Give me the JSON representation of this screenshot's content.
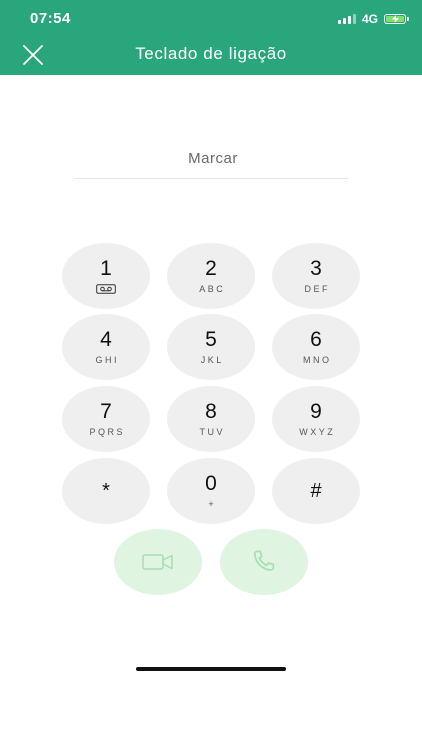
{
  "status_bar": {
    "time": "07:54",
    "network": "4G"
  },
  "header": {
    "title": "Teclado de ligação"
  },
  "dial": {
    "placeholder": "Marcar",
    "value": ""
  },
  "keypad": [
    {
      "digit": "1",
      "letters": "",
      "icon": "voicemail-icon"
    },
    {
      "digit": "2",
      "letters": "ABC"
    },
    {
      "digit": "3",
      "letters": "DEF"
    },
    {
      "digit": "4",
      "letters": "GHI"
    },
    {
      "digit": "5",
      "letters": "JKL"
    },
    {
      "digit": "6",
      "letters": "MNO"
    },
    {
      "digit": "7",
      "letters": "PQRS"
    },
    {
      "digit": "8",
      "letters": "TUV"
    },
    {
      "digit": "9",
      "letters": "WXYZ"
    },
    {
      "digit": "*",
      "letters": ""
    },
    {
      "digit": "0",
      "letters": "+"
    },
    {
      "digit": "#",
      "letters": ""
    }
  ],
  "actions": {
    "video_icon": "video-camera-icon",
    "call_icon": "phone-icon"
  },
  "colors": {
    "header": "#2aa67c",
    "key_bg": "#efefef",
    "action_bg": "#dff5e2",
    "action_icon": "#a9ddb3"
  }
}
